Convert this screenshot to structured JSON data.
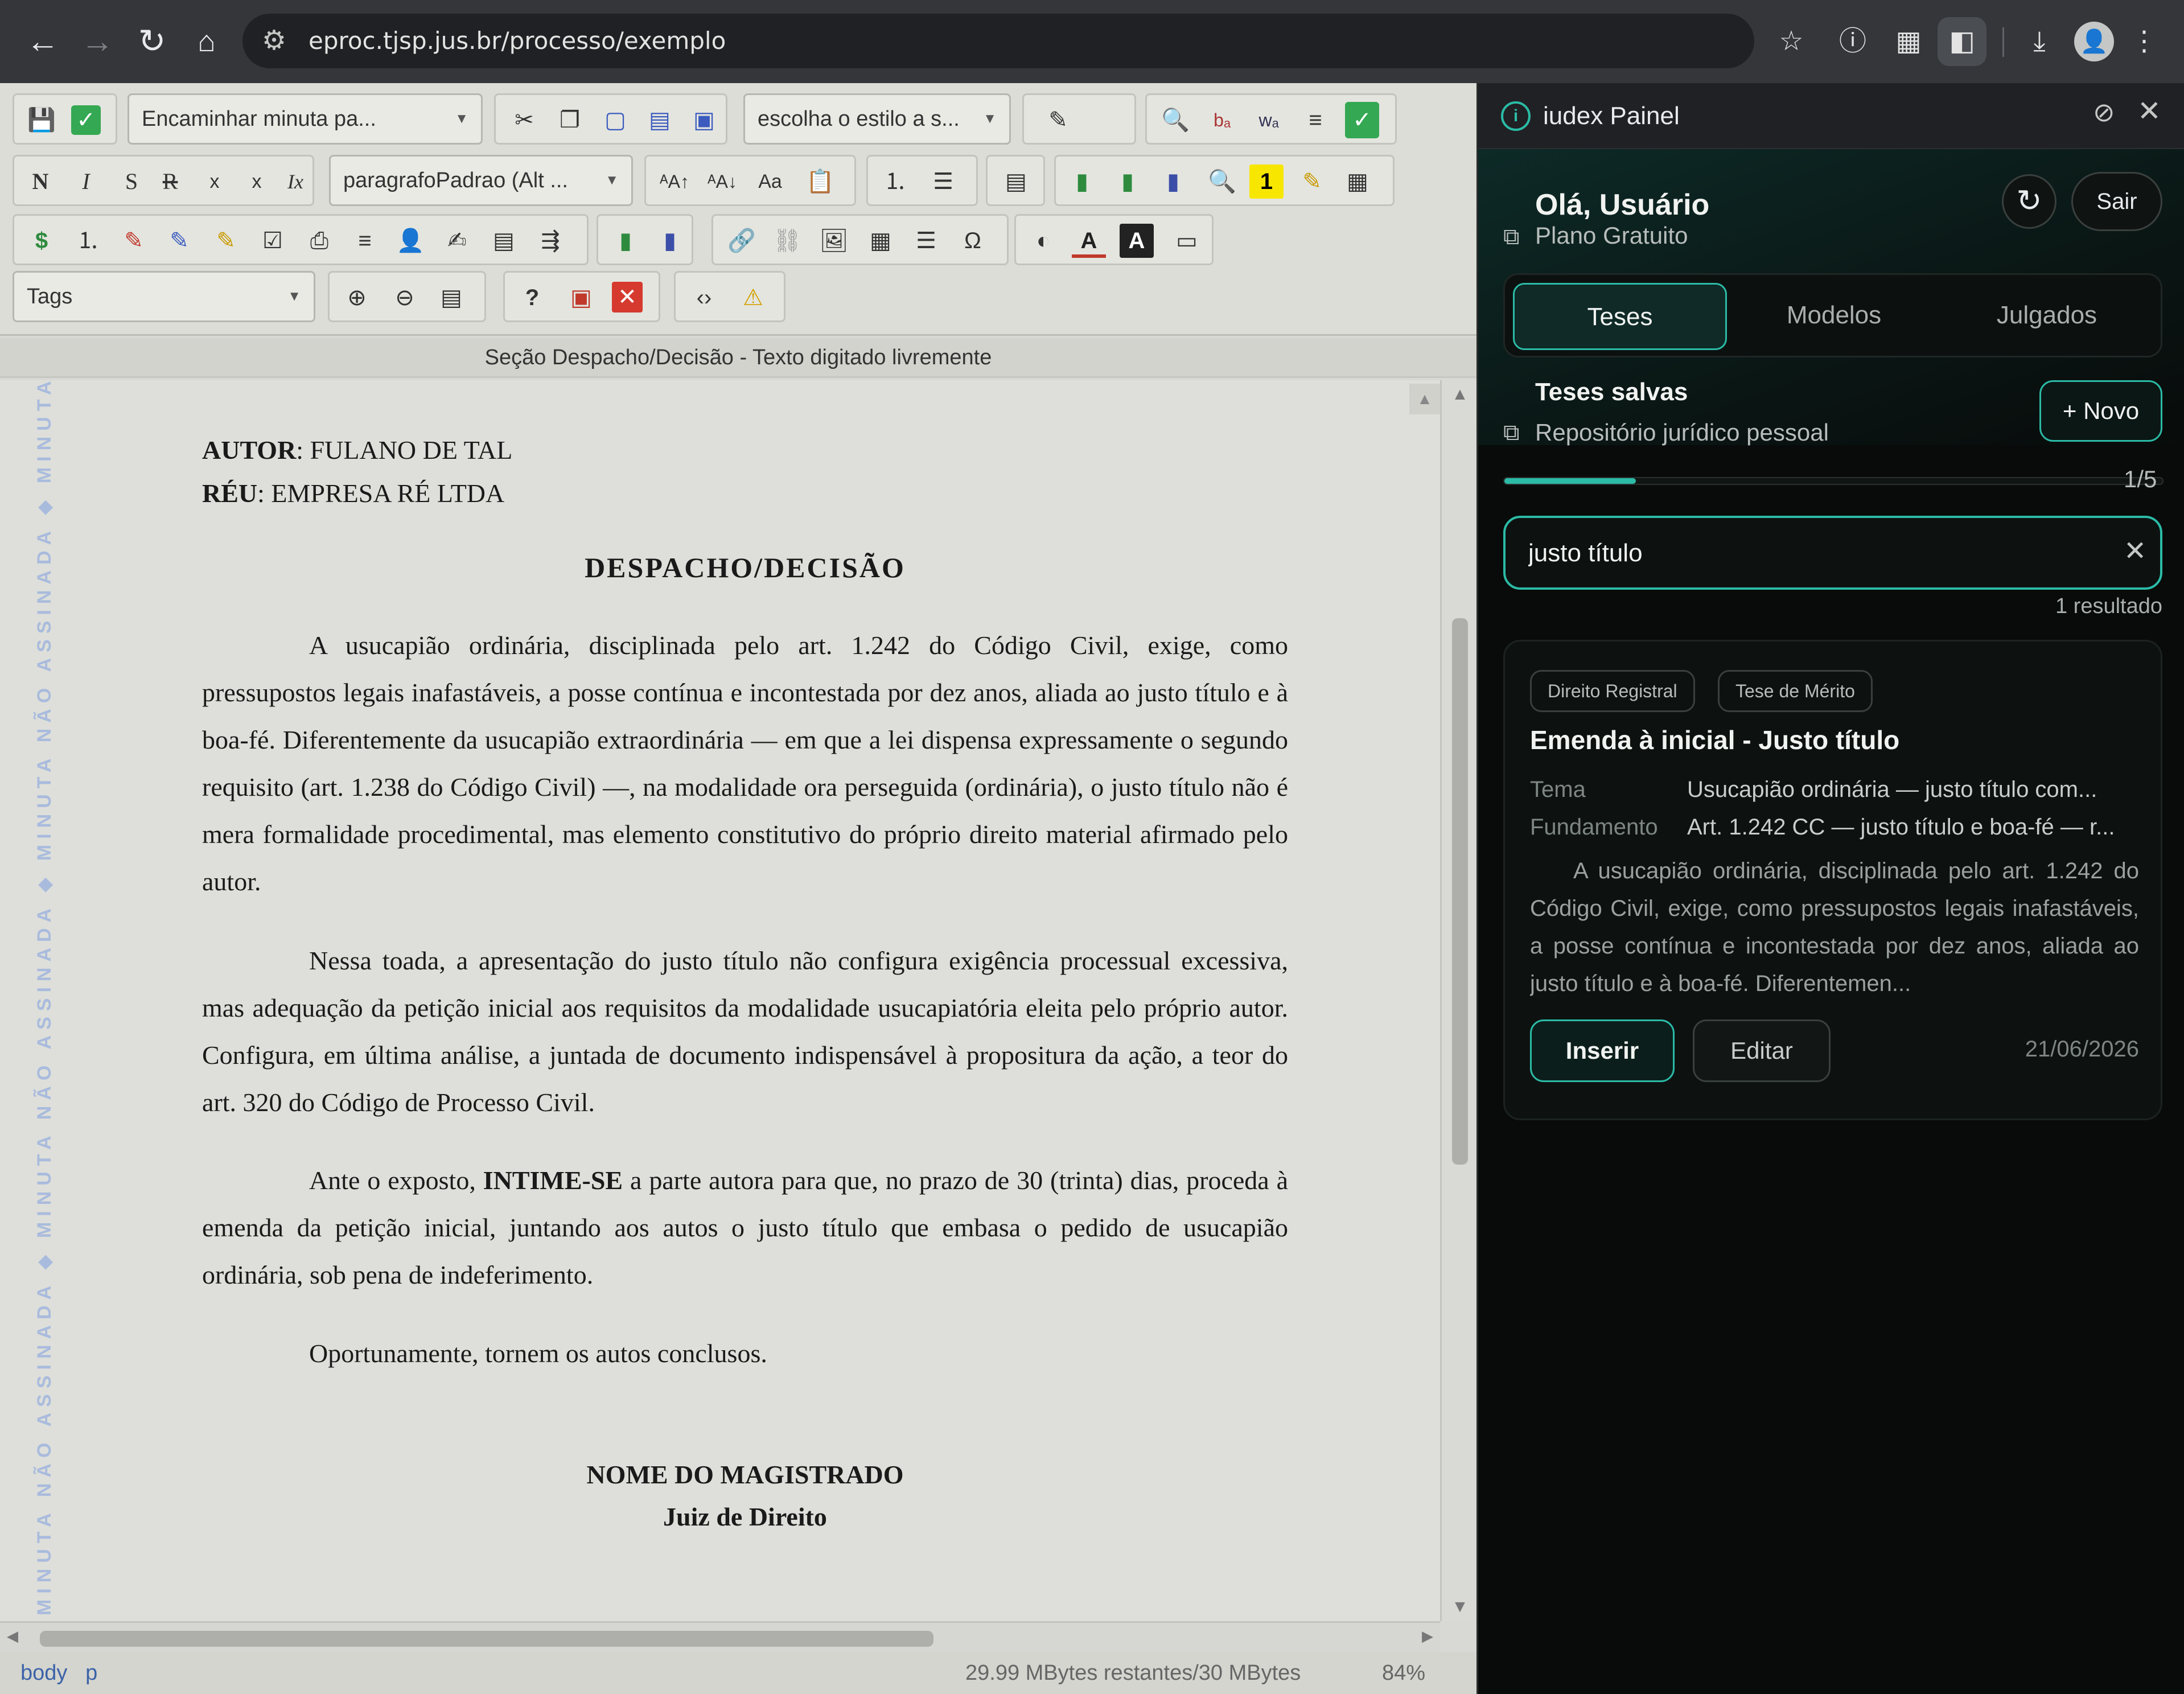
{
  "browser": {
    "url": "eproc.tjsp.jus.br/processo/exemplo",
    "icons": [
      "back-icon",
      "forward-icon",
      "reload-icon",
      "home-icon",
      "tune-icon",
      "star-icon",
      "info-icon",
      "tab-groups-icon",
      "side-panel-icon",
      "download-icon",
      "profile-icon",
      "menu-icon"
    ]
  },
  "editor": {
    "toolbar": {
      "action_combo": "Encaminhar minuta pa...",
      "style_combo": "escolha o estilo a s...",
      "format_combo": "paragrafoPadrao (Alt ...",
      "tags_combo": "Tags",
      "bold": "N",
      "italic": "I",
      "strike": "S",
      "strike2": "R",
      "subscript": "x",
      "superscript": "x",
      "remove_format": "Ix",
      "font_up": "ᴬA↑",
      "font_down": "ᴬA↓",
      "case": "Aa",
      "dollar": "$",
      "help": "?",
      "omega": "Ω",
      "highlight_num": "1",
      "ba": "bₐ",
      "wa": "wₐ"
    },
    "section_title": "Seção Despacho/Decisão - Texto digitado livremente",
    "watermark": "MINUTA NÃO ASSINADA ◆ MINUTA NÃO ASSINADA ◆ MINUTA NÃO ASSINADA ◆ MINUTA NÃO ASSINADA ◆ MINUTA NÃO ASSINADA ◆ MIN",
    "document": {
      "autor_label": "AUTOR",
      "autor_value": ": FULANO DE TAL",
      "reu_label": "RÉU",
      "reu_value": ": EMPRESA RÉ LTDA",
      "title": "DESPACHO/DECISÃO",
      "p1": "A usucapião ordinária, disciplinada pelo art. 1.242 do Código Civil, exige, como pressupostos legais inafastáveis, a posse contínua e incontestada por dez anos, aliada ao justo título e à boa-fé. Diferentemente da usucapião extraordinária — em que a lei dispensa expressamente o segundo requisito (art. 1.238 do Código Civil) —, na modalidade ora perseguida (ordinária), o justo título não é mera formalidade procedimental, mas elemento constitutivo do próprio direito material afirmado pelo autor.",
      "p2": "Nessa toada, a apresentação do justo título não configura exigência processual excessiva, mas adequação da petição inicial aos requisitos da modalidade usucapiatória eleita pelo próprio autor. Configura, em última análise, a juntada de documento indispensável à propositura da ação, a teor do art. 320 do Código de Processo Civil.",
      "p3_prefix": "Ante o exposto, ",
      "p3_bold": "INTIME-SE",
      "p3_suffix": " a parte autora para que, no prazo de 30 (trinta) dias, proceda à emenda da petição inicial, juntando aos autos o justo título que embasa o pedido de usucapião ordinária, sob pena de indeferimento.",
      "p4": "Oportunamente, tornem os autos conclusos.",
      "signer_name": "NOME DO MAGISTRADO",
      "signer_role": "Juiz de Direito"
    },
    "status": {
      "path_body": "body",
      "path_p": "p",
      "memory": "29.99 MBytes restantes/30 MBytes",
      "zoom": "84%"
    }
  },
  "panel": {
    "title": "iudex Painel",
    "greeting": "Olá, Usuário",
    "plan": "Plano Gratuito",
    "logout": "Sair",
    "tabs": [
      "Teses",
      "Modelos",
      "Julgados"
    ],
    "active_tab": "Teses",
    "saved_title": "Teses salvas",
    "repo_link": "Repositório jurídico pessoal",
    "new_button": "+ Novo",
    "progress_fraction": 0.2,
    "progress_label": "1/5",
    "search_value": "justo título",
    "results_label": "1 resultado",
    "card": {
      "tags": [
        "Direito Registral",
        "Tese de Mérito"
      ],
      "title": "Emenda à inicial - Justo título",
      "tema_label": "Tema",
      "tema_value": "Usucapião ordinária — justo título com...",
      "fundamento_label": "Fundamento",
      "fundamento_value": "Art. 1.242 CC — justo título e boa-fé — r...",
      "excerpt": "A usucapião ordinária, disciplinada pelo art. 1.242 do Código Civil, exige, como pressupostos legais inafastáveis, a posse contínua e incontestada por dez anos, aliada ao justo título e à boa-fé. Diferentemen...",
      "insert_button": "Inserir",
      "edit_button": "Editar",
      "date": "21/06/2026"
    },
    "accent_color": "#2bbba6"
  }
}
